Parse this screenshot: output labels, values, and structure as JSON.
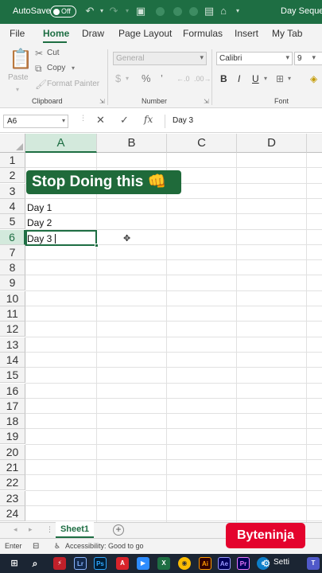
{
  "titlebar": {
    "autosave_label": "AutoSave",
    "autosave_state": "Off",
    "doc_title": "Day Sequen"
  },
  "tabs": [
    "File",
    "Home",
    "Draw",
    "Page Layout",
    "Formulas",
    "Insert",
    "My Tab"
  ],
  "ribbon": {
    "paste_label": "Paste",
    "cut_label": "Cut",
    "copy_label": "Copy",
    "format_painter_label": "Format Painter",
    "clipboard_group": "Clipboard",
    "number_format_value": "General",
    "number_group": "Number",
    "font_name": "Calibri",
    "font_size": "9",
    "font_group": "Font",
    "currency_icon": "$",
    "percent_icon": "%",
    "comma_icon": "’",
    "bold_label": "B",
    "italic_label": "I",
    "underline_label": "U"
  },
  "formula_bar": {
    "name_box": "A6",
    "fx_label": "fx",
    "content": "Day 3"
  },
  "grid": {
    "columns": [
      "A",
      "B",
      "C",
      "D"
    ],
    "selected_column": "A",
    "rows": [
      "1",
      "2",
      "3",
      "4",
      "5",
      "6",
      "7",
      "8",
      "9",
      "10",
      "11",
      "12",
      "13",
      "14",
      "15",
      "16",
      "17",
      "18",
      "19",
      "20",
      "21",
      "22",
      "23",
      "24"
    ],
    "selected_row": "6",
    "cells": {
      "A4": "Day 1",
      "A5": "Day 2",
      "A6": "Day 3"
    },
    "active_cell": "A6"
  },
  "banner": {
    "text": "Stop Doing this 👊"
  },
  "sheets": {
    "active": "Sheet1",
    "add_label": "+"
  },
  "status": {
    "mode": "Enter",
    "accessibility": "Accessibility: Good to go"
  },
  "watermark": "Byteninja",
  "taskbar": {
    "settings_label": "Setti",
    "items": [
      "Lr",
      "Ps",
      "Ai",
      "Ae",
      "Pr"
    ]
  },
  "colors": {
    "excel_green": "#1e6e43",
    "banner_green": "#1f6a3a",
    "watermark_red": "#e4032d",
    "taskbar": "#1b2533"
  }
}
